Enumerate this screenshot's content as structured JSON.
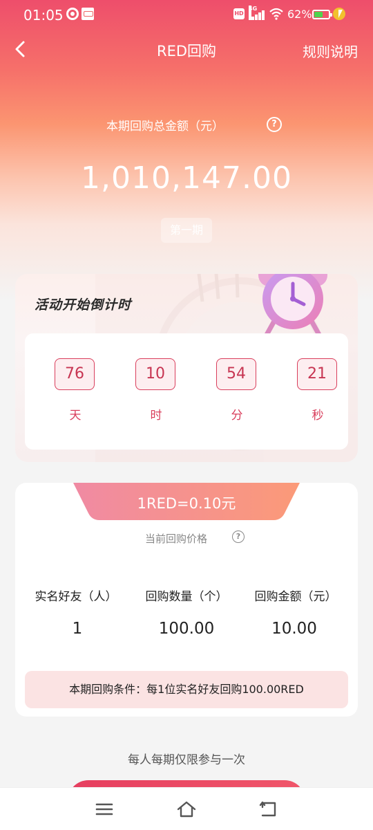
{
  "status_bar": {
    "time": "01:05",
    "network": "4G",
    "hd": "HD",
    "battery_percent": "62%",
    "battery_level": 0.62
  },
  "nav": {
    "title": "RED回购",
    "rules_label": "规则说明"
  },
  "hero": {
    "total_label": "本期回购总金额（元）",
    "total_amount": "1,010,147.00",
    "period_label": "第一期"
  },
  "countdown": {
    "title": "活动开始倒计时",
    "cells": [
      {
        "value": "76",
        "unit": "天"
      },
      {
        "value": "10",
        "unit": "时"
      },
      {
        "value": "54",
        "unit": "分"
      },
      {
        "value": "21",
        "unit": "秒"
      }
    ]
  },
  "price": {
    "rate": "1RED=0.10元",
    "subtitle": "当前回购价格",
    "columns": [
      {
        "header": "实名好友（人）",
        "value": "1"
      },
      {
        "header": "回购数量（个）",
        "value": "100.00"
      },
      {
        "header": "回购金额（元）",
        "value": "10.00"
      }
    ],
    "condition": "本期回购条件：每1位实名好友回购100.00RED"
  },
  "limit_note": "每人每期仅限参与一次",
  "colors": {
    "accent": "#d93d5b",
    "banner_start": "#f08aa3",
    "banner_end": "#fb9a78"
  }
}
